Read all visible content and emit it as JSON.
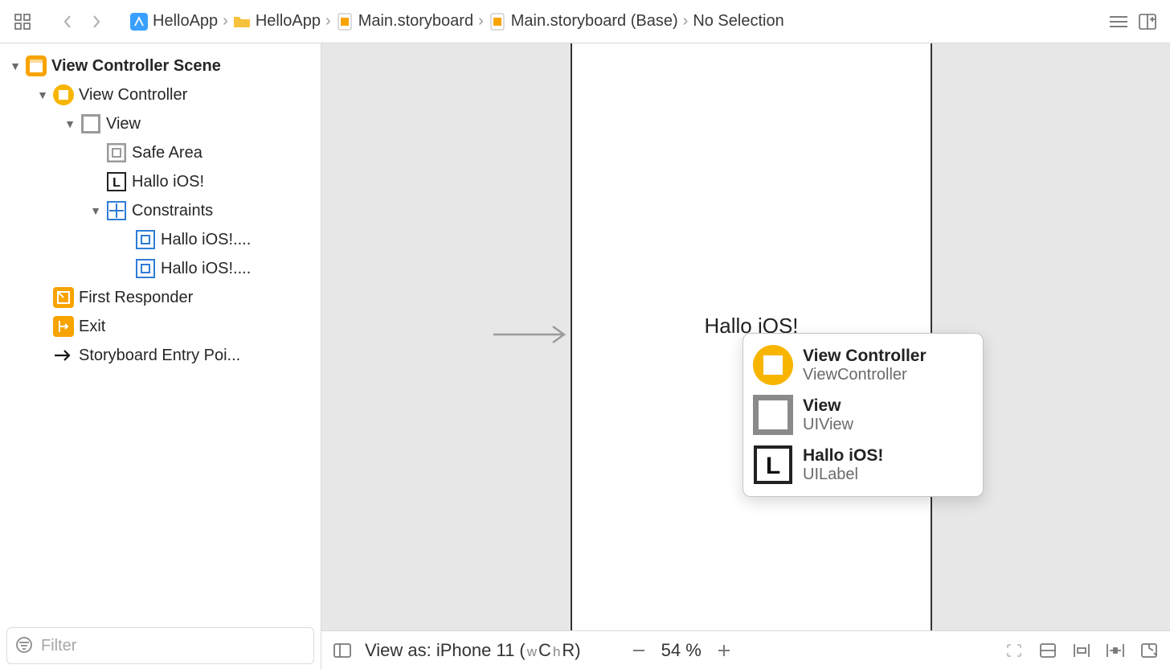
{
  "breadcrumbs": {
    "items": [
      {
        "label": "HelloApp"
      },
      {
        "label": "HelloApp"
      },
      {
        "label": "Main.storyboard"
      },
      {
        "label": "Main.storyboard (Base)"
      },
      {
        "label": "No Selection"
      }
    ]
  },
  "outline": {
    "scene": "View Controller Scene",
    "viewController": "View Controller",
    "view": "View",
    "safeArea": "Safe Area",
    "halloLabel": "Hallo iOS!",
    "constraints": "Constraints",
    "constraint1": "Hallo iOS!....",
    "constraint2": "Hallo iOS!....",
    "firstResponder": "First Responder",
    "exit": "Exit",
    "entryPoint": "Storyboard Entry Poi..."
  },
  "filter": {
    "placeholder": "Filter"
  },
  "canvas": {
    "labelText": "Hallo iOS!"
  },
  "popup": {
    "items": [
      {
        "title": "View Controller",
        "sub": "ViewController"
      },
      {
        "title": "View",
        "sub": "UIView"
      },
      {
        "title": "Hallo iOS!",
        "sub": "UILabel"
      }
    ]
  },
  "bottombar": {
    "viewAs": "View as: iPhone 11 (",
    "wc": "w",
    "cLetter": "C ",
    "hLetter": "h",
    "rLetter": "R)",
    "zoom": "54 %"
  }
}
